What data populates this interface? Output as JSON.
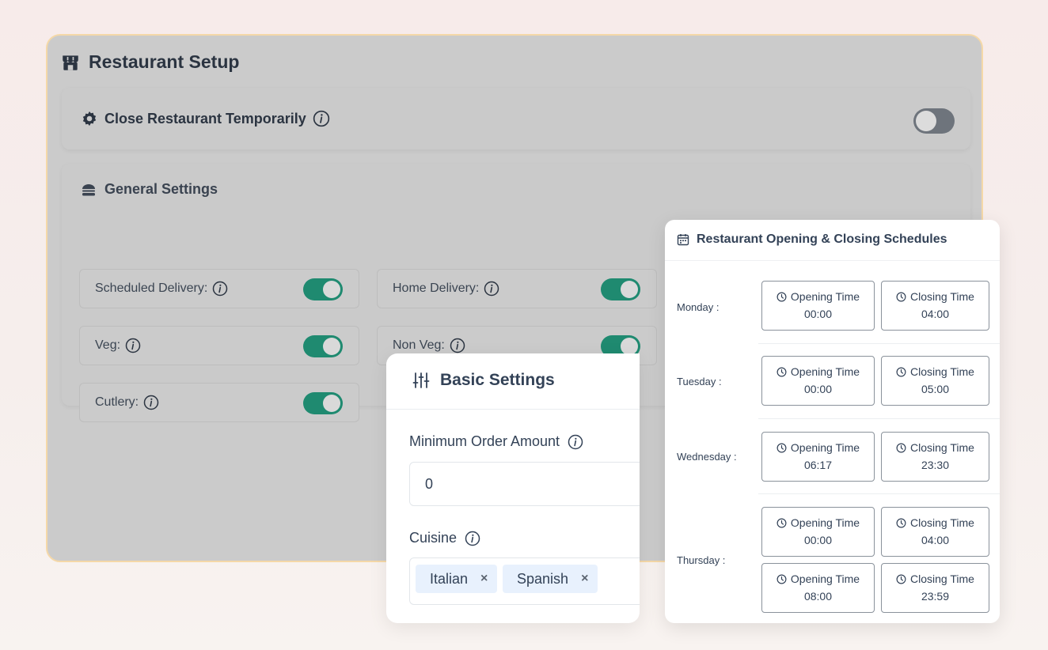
{
  "setup": {
    "title": "Restaurant Setup",
    "close_label": "Close Restaurant Temporarily",
    "close_enabled": false,
    "general_title": "General Settings",
    "options": [
      {
        "label": "Scheduled Delivery:",
        "enabled": true
      },
      {
        "label": "Home Delivery:",
        "enabled": true
      },
      {
        "label": "Veg:",
        "enabled": true
      },
      {
        "label": "Non Veg:",
        "enabled": true
      },
      {
        "label": "Cutlery:",
        "enabled": true
      }
    ]
  },
  "basic": {
    "title": "Basic Settings",
    "min_order_label": "Minimum Order Amount",
    "min_order_value": "0",
    "cuisine_label": "Cuisine",
    "cuisines": [
      "Italian",
      "Spanish"
    ],
    "remove_symbol": "×"
  },
  "schedule": {
    "title": "Restaurant Opening & Closing Schedules",
    "opening_label": "Opening Time",
    "closing_label": "Closing Time",
    "days": [
      {
        "day": "Monday :",
        "slots": [
          {
            "open": "00:00",
            "close": "04:00"
          }
        ]
      },
      {
        "day": "Tuesday :",
        "slots": [
          {
            "open": "00:00",
            "close": "05:00"
          }
        ]
      },
      {
        "day": "Wednesday :",
        "slots": [
          {
            "open": "06:17",
            "close": "23:30"
          }
        ]
      },
      {
        "day": "Thursday :",
        "slots": [
          {
            "open": "00:00",
            "close": "04:00"
          },
          {
            "open": "08:00",
            "close": "23:59"
          }
        ]
      }
    ]
  },
  "colors": {
    "toggle_on": "#1f8a70",
    "toggle_off": "#6e747c",
    "panel_border": "#f5d8a8",
    "tag_bg": "#e8f1fd"
  },
  "icons": {
    "setup": "store-icon",
    "close": "gear-icon",
    "general": "burger-icon",
    "basic": "sliders-icon",
    "schedule": "calendar-icon",
    "time": "clock-icon",
    "info": "info-icon"
  }
}
